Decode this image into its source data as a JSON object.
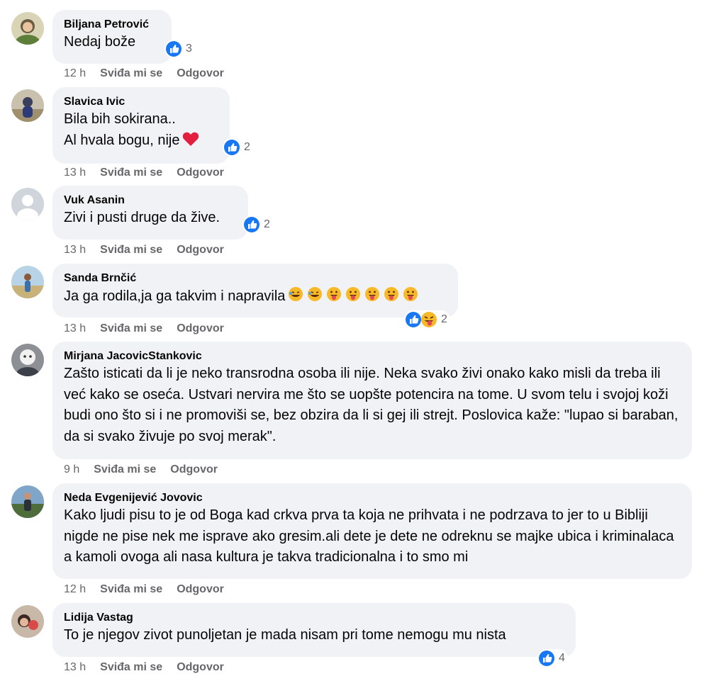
{
  "comments": [
    {
      "author": "Biljana Petrović",
      "lines": [
        "Nedaj bože"
      ],
      "time": "12 h",
      "like": "Sviđa mi se",
      "reply": "Odgovor",
      "reactions": "3"
    },
    {
      "author": "Slavica Ivic",
      "lines": [
        "Bila bih sokirana..",
        "Al hvala bogu, nije"
      ],
      "time": "13 h",
      "like": "Sviđa mi se",
      "reply": "Odgovor",
      "reactions": "2"
    },
    {
      "author": "Vuk Asanin",
      "lines": [
        "Zivi i pusti druge da žive."
      ],
      "time": "13 h",
      "like": "Sviđa mi se",
      "reply": "Odgovor",
      "reactions": "2"
    },
    {
      "author": "Sanda Brnčić",
      "lines": [
        "Ja ga rodila,ja ga takvim i napravila"
      ],
      "time": "13 h",
      "like": "Sviđa mi se",
      "reply": "Odgovor",
      "reactions": "2"
    },
    {
      "author": "Mirjana JacovicStankovic",
      "lines": [
        "Zašto isticati da li je neko transrodna osoba ili nije. Neka svako živi onako kako misli da treba ili već kako se oseća. Ustvari nervira me što se uopšte potencira na tome. U svom telu i svojoj koži budi ono što si i ne promoviši se, bez obzira da li si gej ili strejt. Poslovica kaže: \"lupao si baraban, da si svako živuje po svoj merak\"."
      ],
      "time": "9 h",
      "like": "Sviđa mi se",
      "reply": "Odgovor"
    },
    {
      "author": "Neda Evgenijević Jovovic",
      "lines": [
        "Kako ljudi pisu to je od Boga kad crkva prva ta koja ne prihvata i ne podrzava to jer to u Bibliji nigde ne pise nek me isprave ako gresim.ali dete je dete ne odreknu se majke ubica i kriminalaca a kamoli ovoga ali nasa kultura je takva tradicionalna i to smo mi"
      ],
      "time": "12 h",
      "like": "Sviđa mi se",
      "reply": "Odgovor"
    },
    {
      "author": "Lidija Vastag",
      "lines": [
        "To je njegov zivot punoljetan je mada nisam pri tome nemogu mu nista"
      ],
      "time": "13 h",
      "like": "Sviđa mi se",
      "reply": "Odgovor",
      "reactions": "4"
    }
  ],
  "icons": {
    "like": "like-reaction-icon",
    "haha": "laughing-emoji",
    "tongue": "tongue-emoji",
    "heart": "red-heart-emoji",
    "like_color": "#1877f2",
    "heart_color": "#e41e3f",
    "bubble_color": "#f0f2f5",
    "meta_color": "#65676b"
  }
}
